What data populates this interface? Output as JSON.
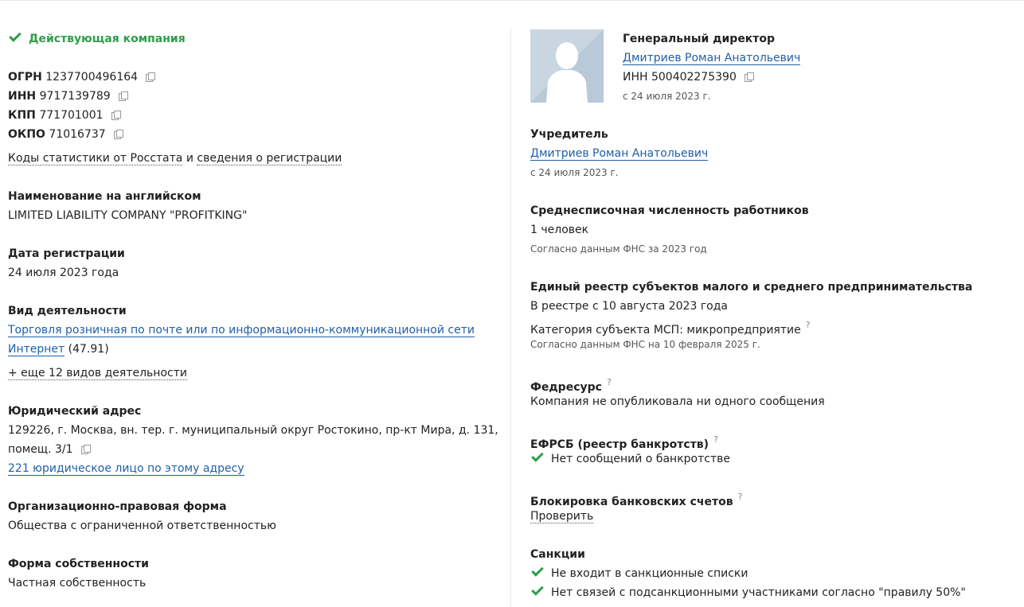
{
  "status": {
    "label": "Действующая компания",
    "color": "#2e9e4a"
  },
  "ids": [
    {
      "label": "ОГРН",
      "value": "1237700496164"
    },
    {
      "label": "ИНН",
      "value": "9717139789"
    },
    {
      "label": "КПП",
      "value": "771701001"
    },
    {
      "label": "ОКПО",
      "value": "71016737"
    }
  ],
  "stats_link": {
    "part1": "Коды статистики от Росстата",
    "conj": "и",
    "part2": "сведения о регистрации"
  },
  "english_name": {
    "title": "Наименование на английском",
    "value": "LIMITED LIABILITY COMPANY \"PROFITKING\""
  },
  "reg_date": {
    "title": "Дата регистрации",
    "value": "24 июля 2023 года"
  },
  "activity": {
    "title": "Вид деятельности",
    "line1": "Торговля розничная по почте или по информационно-коммуникационной сети",
    "line2": "Интернет",
    "code": "(47.91)",
    "more": "+ еще 12 видов деятельности"
  },
  "address": {
    "title": "Юридический адрес",
    "line1": "129226, г. Москва, вн. тер. г. муниципальный округ Ростокино, пр-кт Мира, д. 131,",
    "line2": "помещ. 3/1",
    "link": "221 юридическое лицо по этому адресу"
  },
  "legal_form": {
    "title": "Организационно-правовая форма",
    "value": "Общества с ограниченной ответственностью"
  },
  "ownership": {
    "title": "Форма собственности",
    "value": "Частная собственность"
  },
  "director": {
    "title": "Генеральный директор",
    "name": "Дмитриев Роман Анатольевич",
    "inn_label": "ИНН",
    "inn": "500402275390",
    "since": "с 24 июля 2023 г."
  },
  "founder": {
    "title": "Учредитель",
    "name": "Дмитриев Роман Анатольевич",
    "since": "с 24 июля 2023 г."
  },
  "employees": {
    "title": "Среднесписочная численность работников",
    "value": "1 человек",
    "note": "Согласно данным ФНС за 2023 год"
  },
  "msp": {
    "title": "Единый реестр субъектов малого и среднего предпринимательства",
    "line1": "В реестре с 10 августа 2023 года",
    "line2": "Категория субъекта МСП: микропредприятие",
    "q": "?",
    "note": "Согласно данным ФНС на 10 февраля 2025 г."
  },
  "fedresurs": {
    "title": "Федресурс",
    "q": "?",
    "value": "Компания не опубликовала ни одного сообщения"
  },
  "efrsb": {
    "title": "ЕФРСБ (реестр банкротств)",
    "q": "?",
    "value": "Нет сообщений о банкротстве"
  },
  "blocking": {
    "title": "Блокировка банковских счетов",
    "q": "?",
    "link": "Проверить"
  },
  "sanctions": {
    "title": "Санкции",
    "item1": "Не входит в санкционные списки",
    "item2": "Нет связей с подсанкционными участниками согласно \"правилу 50%\""
  }
}
